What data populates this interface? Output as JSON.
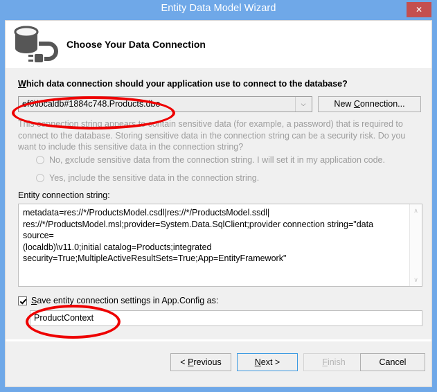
{
  "window": {
    "title": "Entity Data Model Wizard",
    "close_label": "✕",
    "titlebar_color": "#6fa8e8",
    "close_color": "#c44f4f"
  },
  "header": {
    "icon": "database-connection-icon",
    "heading": "Choose Your Data Connection"
  },
  "body": {
    "question_label": {
      "accel": "W",
      "rest": "hich data connection should your application use to connect to the database?"
    },
    "connection_combo": {
      "value": "ef6\\localdb#1884c748.Products.dbo",
      "arrow": "⌵"
    },
    "new_connection_button": {
      "pre": "New ",
      "accel": "C",
      "post": "onnection..."
    },
    "sensitive_note": "This connection string appears to contain sensitive data (for example, a password) that is required to connect to the database. Storing sensitive data in the connection string can be a security risk. Do you want to include this sensitive data in the connection string?",
    "radio_options": [
      {
        "pre": "No, ",
        "accel": "e",
        "post": "xclude sensitive data from the connection string. I will set it in my application code.",
        "selected": false,
        "enabled": false
      },
      {
        "pre": "Yes, ",
        "accel": "i",
        "post": "nclude the sensitive data in the connection string.",
        "selected": false,
        "enabled": false
      }
    ],
    "entity_connection_label": "Entity connection string:",
    "entity_connection_string": "metadata=res://*/ProductsModel.csdl|res://*/ProductsModel.ssdl|\nres://*/ProductsModel.msl;provider=System.Data.SqlClient;provider connection string=\"data source=\n(localdb)\\v11.0;initial catalog=Products;integrated\nsecurity=True;MultipleActiveResultSets=True;App=EntityFramework\"",
    "scroll_up": "∧",
    "scroll_down": "∨",
    "save_checkbox": {
      "checked": true,
      "accel": "S",
      "post": "ave entity connection settings in App.Config as:"
    },
    "context_input": {
      "value": "ProductContext"
    }
  },
  "footer": {
    "buttons": [
      {
        "pre": "< ",
        "accel": "P",
        "post": "revious",
        "enabled": true,
        "focused": false
      },
      {
        "pre": "",
        "accel": "N",
        "post": "ext >",
        "enabled": true,
        "focused": true
      },
      {
        "pre": "",
        "accel": "F",
        "post": "inish",
        "enabled": false,
        "focused": false
      },
      {
        "pre": "",
        "accel": "",
        "post": "Cancel",
        "enabled": true,
        "focused": false
      }
    ]
  },
  "annotations": {
    "color": "#ee0000",
    "items": [
      {
        "name": "annotation-ellipse-connection-combo"
      },
      {
        "name": "annotation-ellipse-context-name"
      }
    ]
  }
}
